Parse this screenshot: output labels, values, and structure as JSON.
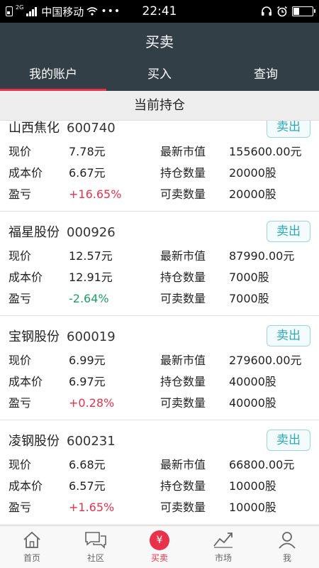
{
  "status_bar": {
    "network": "2G",
    "carrier": "中国移动",
    "time": "22:41"
  },
  "header": {
    "title": "买卖",
    "tabs": [
      {
        "label": "我的账户",
        "active": true
      },
      {
        "label": "买入",
        "active": false
      },
      {
        "label": "查询",
        "active": false
      }
    ]
  },
  "section": {
    "title": "当前持仓"
  },
  "sell_label": "卖出",
  "labels": {
    "price": "现价",
    "cost": "成本价",
    "pnl": "盈亏",
    "market_value": "最新市值",
    "holding": "持仓数量",
    "sellable": "可卖数量"
  },
  "holdings": [
    {
      "name": "山西焦化",
      "code": "600740",
      "price": "7.78元",
      "cost": "6.67元",
      "pnl": "+16.65%",
      "market_value": "155600.00元",
      "holding": "20000股",
      "sellable": "20000股"
    },
    {
      "name": "福星股份",
      "code": "000926",
      "price": "12.57元",
      "cost": "12.91元",
      "pnl": "-2.64%",
      "market_value": "87990.00元",
      "holding": "7000股",
      "sellable": "7000股"
    },
    {
      "name": "宝钢股份",
      "code": "600019",
      "price": "6.99元",
      "cost": "6.97元",
      "pnl": "+0.28%",
      "market_value": "279600.00元",
      "holding": "40000股",
      "sellable": "40000股"
    },
    {
      "name": "凌钢股份",
      "code": "600231",
      "price": "6.68元",
      "cost": "6.57元",
      "pnl": "+1.65%",
      "market_value": "66800.00元",
      "holding": "10000股",
      "sellable": "10000股"
    }
  ],
  "bottom_nav": [
    {
      "label": "首页",
      "icon": "home-icon"
    },
    {
      "label": "社区",
      "icon": "chat-icon"
    },
    {
      "label": "买卖",
      "icon": "yen-icon",
      "active": true
    },
    {
      "label": "市场",
      "icon": "chart-icon"
    },
    {
      "label": "我",
      "icon": "user-icon"
    }
  ],
  "colors": {
    "accent_red": "#e8314b",
    "gain": "#e8314b",
    "loss": "#1aa260",
    "header_bg": "#333f47",
    "sell_button": "#2aa9b8"
  }
}
